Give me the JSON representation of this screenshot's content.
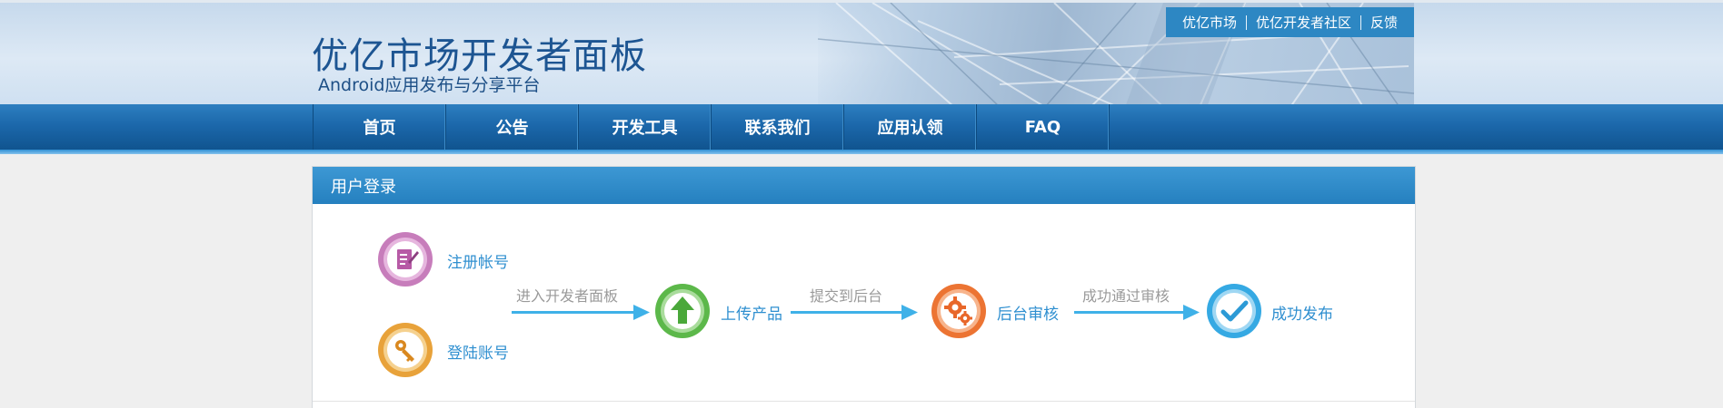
{
  "header": {
    "title": "优亿市场开发者面板",
    "subtitle": "Android应用发布与分享平台",
    "top_links": [
      "优亿市场",
      "优亿开发者社区",
      "反馈"
    ]
  },
  "nav": {
    "items": [
      "首页",
      "公告",
      "开发工具",
      "联系我们",
      "应用认领",
      "FAQ"
    ]
  },
  "panel": {
    "title": "用户登录",
    "steps": {
      "register": "注册帐号",
      "login": "登陆账号",
      "upload": "上传产品",
      "review": "后台审核",
      "publish": "成功发布"
    },
    "captions": {
      "enter": "进入开发者面板",
      "submit": "提交到后台",
      "pass": "成功通过审核"
    }
  },
  "colors": {
    "nav_bar": "#1c68ab",
    "panel_header": "#2d87c3",
    "step_label": "#2f8fd0",
    "register_icon": "#c77dbb",
    "login_icon": "#e8a23a",
    "upload_icon": "#5cb84a",
    "review_icon": "#ec7433",
    "publish_icon": "#35a9e3"
  },
  "icons": {
    "register": "edit-document-icon",
    "login": "key-icon",
    "upload": "upload-arrow-icon",
    "review": "gears-icon",
    "publish": "checkmark-icon"
  }
}
